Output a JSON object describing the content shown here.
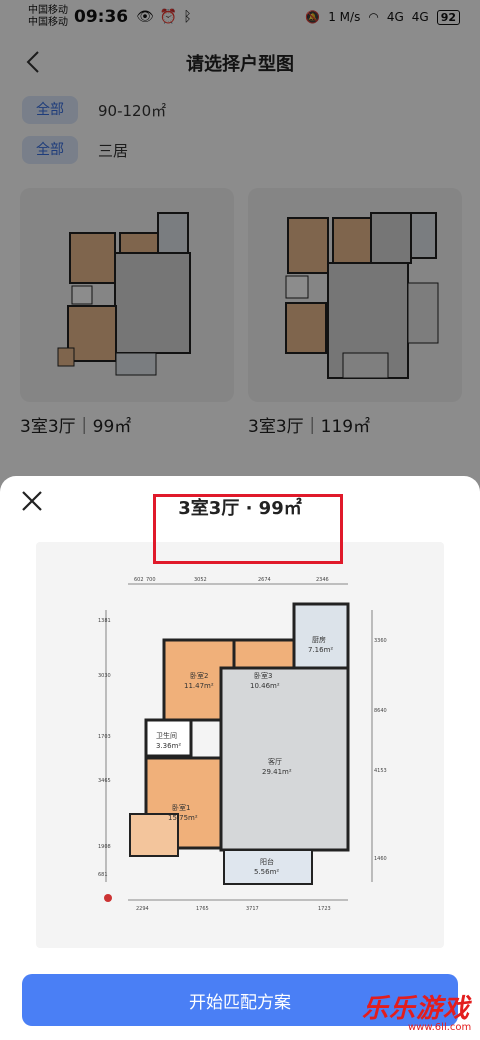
{
  "status": {
    "carrier1": "中国移动",
    "carrier2": "中国移动",
    "time": "09:36",
    "net_speed": "1 M/s",
    "signal1": "4G",
    "signal2": "4G",
    "battery": "92"
  },
  "header": {
    "title": "请选择户型图"
  },
  "filters": [
    {
      "chip": "全部",
      "value": "90-120㎡"
    },
    {
      "chip": "全部",
      "value": "三居"
    }
  ],
  "cards": [
    {
      "caption": "3室3厅｜99㎡"
    },
    {
      "caption": "3室3厅｜119㎡"
    }
  ],
  "sheet": {
    "title": "3室3厅 · 99㎡",
    "button_label": "开始匹配方案"
  },
  "floorplan": {
    "rooms": [
      {
        "name": "厨房",
        "area": "7.16m²"
      },
      {
        "name": "卧室2",
        "area": "11.47m²"
      },
      {
        "name": "卧室3",
        "area": "10.46m²"
      },
      {
        "name": "卫生间",
        "area": "3.36m²"
      },
      {
        "name": "客厅",
        "area": "29.41m²"
      },
      {
        "name": "卧室1",
        "area": "15.75m²"
      },
      {
        "name": "阳台",
        "area": "5.56m²"
      }
    ],
    "dims_top": [
      "602",
      "700",
      "3052",
      "2674",
      "2346"
    ],
    "dims_bottom": [
      "2294",
      "1765",
      "3717",
      "1723"
    ],
    "dims_left": [
      "1381",
      "3030",
      "1703",
      "3465",
      "1908",
      "681"
    ],
    "dims_right": [
      "3360",
      "8640",
      "4153",
      "1460"
    ]
  },
  "watermark": {
    "title": "乐乐游戏",
    "url": "www.6ll.com"
  },
  "colors": {
    "accent": "#4a7ff5",
    "chip_bg": "#dce8fb",
    "highlight": "#e0192a"
  }
}
